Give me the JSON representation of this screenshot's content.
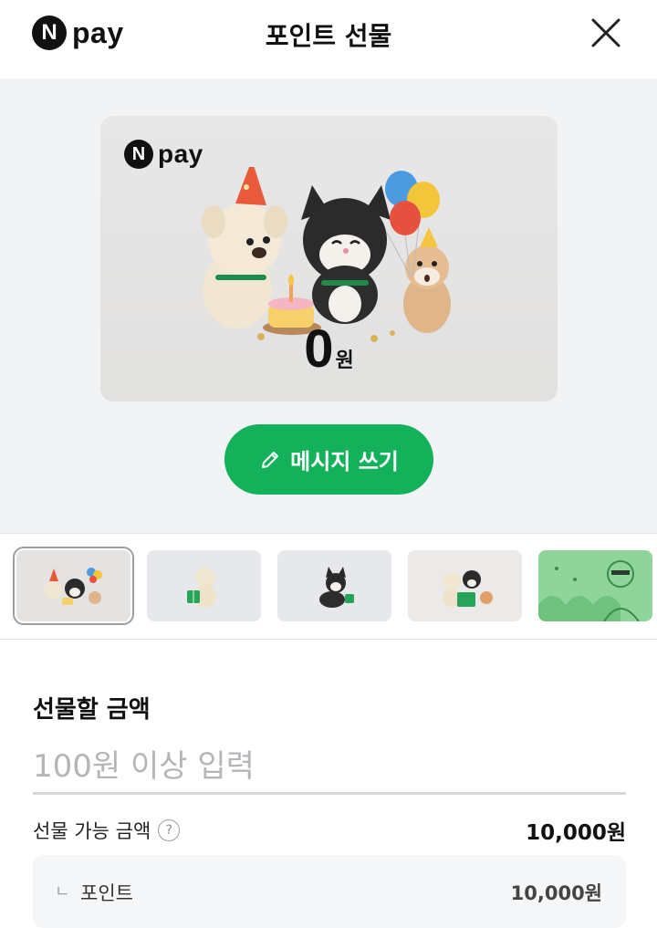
{
  "header": {
    "logo_n": "N",
    "logo_pay": "pay",
    "title": "포인트 선물",
    "close_icon": "close-icon"
  },
  "card": {
    "logo_n": "N",
    "logo_pay": "pay",
    "amount": "0",
    "unit": "원"
  },
  "message_button": {
    "icon": "pencil-icon",
    "label": "메시지 쓰기"
  },
  "thumbnails": {
    "selected_index": 0,
    "items": [
      "birthday-party-thumbnail",
      "dog-gift-thumbnail",
      "cat-gift-thumbnail",
      "friends-gift-thumbnail",
      "green-illustration-thumbnail"
    ]
  },
  "gift_amount": {
    "title": "선물할 금액",
    "placeholder": "100원 이상 입력",
    "value": ""
  },
  "available": {
    "label": "선물 가능 금액",
    "help_icon": "?",
    "value": "10,000원"
  },
  "breakdown": {
    "prefix": "ㄴ",
    "label": "포인트",
    "value": "10,000원"
  },
  "colors": {
    "accent_green": "#12b15a",
    "card_bg": "#e4e4e3",
    "area_bg": "#f2f3f5"
  }
}
